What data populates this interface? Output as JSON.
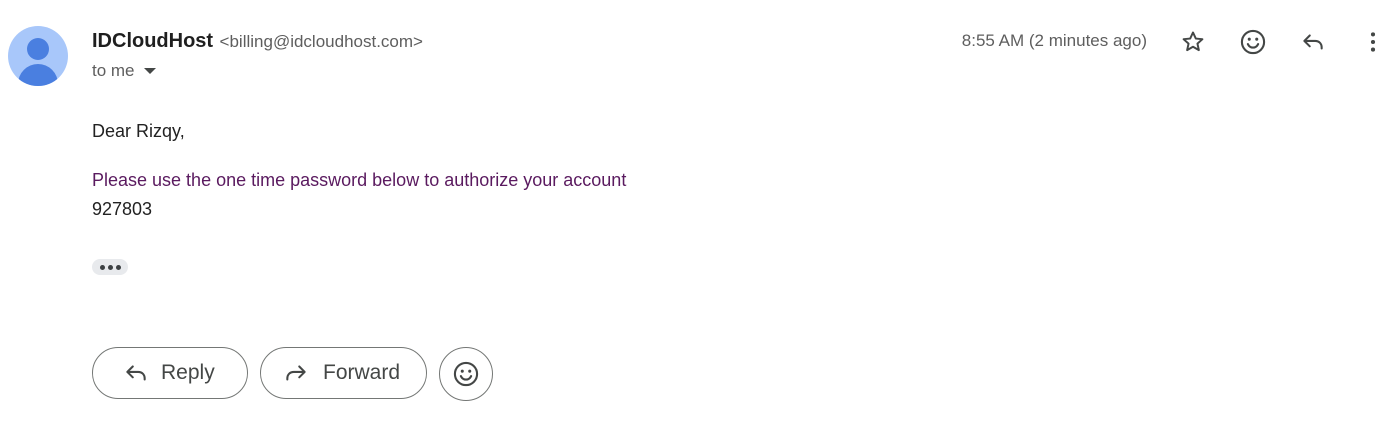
{
  "email": {
    "sender_name": "IDCloudHost",
    "sender_email": "<billing@idcloudhost.com>",
    "recipient_label": "to me",
    "timestamp": "8:55 AM (2 minutes ago)"
  },
  "header_actions": {
    "icons": [
      "star-icon",
      "emoji-icon",
      "reply-icon",
      "more-vert-icon"
    ]
  },
  "message": {
    "greeting": "Dear Rizqy,",
    "instruction": "Please use the one time password below to authorize your account",
    "otp_code": "927803"
  },
  "actions": {
    "reply_label": "Reply",
    "forward_label": "Forward"
  },
  "colors": {
    "avatar_bg": "#a8c7fa",
    "avatar_fg": "#4a7fe0",
    "instruction_text": "#5a1a5f"
  }
}
